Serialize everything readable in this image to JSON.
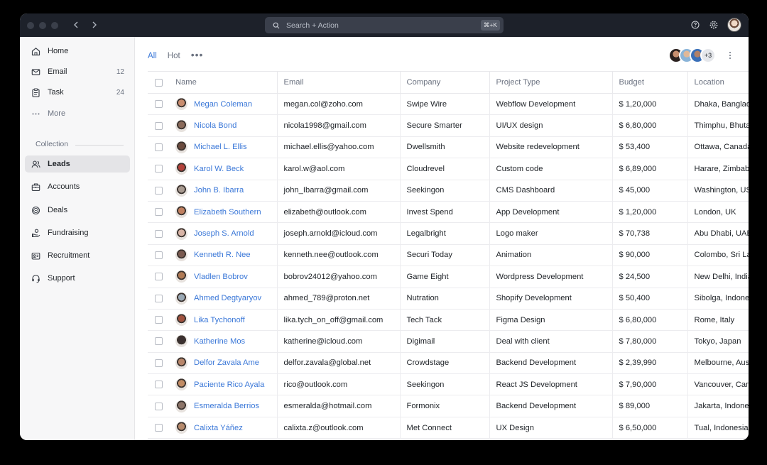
{
  "search": {
    "placeholder": "Search + Action",
    "shortcut": "⌘+K"
  },
  "sidebar": {
    "items": [
      {
        "label": "Home",
        "icon": "home-icon",
        "count": ""
      },
      {
        "label": "Email",
        "icon": "mail-icon",
        "count": "12"
      },
      {
        "label": "Task",
        "icon": "clipboard-icon",
        "count": "24"
      },
      {
        "label": "More",
        "icon": "more-dots-icon",
        "count": ""
      }
    ],
    "collection_label": "Collection",
    "collection": [
      {
        "label": "Leads",
        "icon": "users-icon",
        "active": true
      },
      {
        "label": "Accounts",
        "icon": "briefcase-icon"
      },
      {
        "label": "Deals",
        "icon": "coin-icon"
      },
      {
        "label": "Fundraising",
        "icon": "hand-coin-icon"
      },
      {
        "label": "Recruitment",
        "icon": "id-card-icon"
      },
      {
        "label": "Support",
        "icon": "headset-icon"
      }
    ]
  },
  "tabs": [
    {
      "label": "All",
      "active": true
    },
    {
      "label": "Hot",
      "active": false
    }
  ],
  "more_tabs": "•••",
  "collaborators": {
    "extra": "+3"
  },
  "table": {
    "columns": [
      "Name",
      "Email",
      "Company",
      "Project Type",
      "Budget",
      "Location"
    ],
    "rows": [
      {
        "name": "Megan Coleman",
        "email": "megan.col@zoho.com",
        "company": "Swipe Wire",
        "project": "Webflow Development",
        "budget": "$ 1,20,000",
        "location": "Dhaka,  Bangladesh",
        "color": "#c98d6f"
      },
      {
        "name": "Nicola Bond",
        "email": "nicola1998@gmail.com",
        "company": "Secure Smarter",
        "project": "UI/UX design",
        "budget": "$ 6,80,000",
        "location": "Thimphu, Bhutan",
        "color": "#8a6a5a"
      },
      {
        "name": "Michael L. Ellis",
        "email": "michael.ellis@yahoo.com",
        "company": "Dwellsmith",
        "project": "Website redevelopment",
        "budget": "$ 53,400",
        "location": "Ottawa, Canada",
        "color": "#6b4b3e"
      },
      {
        "name": "Karol W. Beck",
        "email": "karol.w@aol.com",
        "company": "Cloudrevel",
        "project": "Custom code",
        "budget": "$ 6,89,000",
        "location": "Harare, Zimbabwe",
        "color": "#b3413a"
      },
      {
        "name": "John B. Ibarra",
        "email": "john_Ibarra@gmail.com",
        "company": "Seekingon",
        "project": "CMS Dashboard",
        "budget": "$ 45,000",
        "location": "Washington, USA",
        "color": "#a89a90"
      },
      {
        "name": "Elizabeth Southern",
        "email": "elizabeth@outlook.com",
        "company": "Invest Spend",
        "project": "App Development",
        "budget": "$ 1,20,000",
        "location": "London, UK",
        "color": "#c08060"
      },
      {
        "name": "Joseph S. Arnold",
        "email": "joseph.arnold@icloud.com",
        "company": "Legalbright",
        "project": "Logo maker",
        "budget": "$ 70,738",
        "location": "Abu Dhabi, UAE",
        "color": "#d8b4a6"
      },
      {
        "name": "Kenneth R. Nee",
        "email": "kenneth.nee@outlook.com",
        "company": "Securi Today",
        "project": "Animation",
        "budget": "$ 90,000",
        "location": "Colombo, Sri Lanka",
        "color": "#7a5a50"
      },
      {
        "name": "Vladlen Bobrov",
        "email": "bobrov24012@yahoo.com",
        "company": "Game Eight",
        "project": "Wordpress Development",
        "budget": "$ 24,500",
        "location": "New Delhi, India",
        "color": "#b07a55"
      },
      {
        "name": "Ahmed Degtyaryov",
        "email": "ahmed_789@proton.net",
        "company": "Nutration",
        "project": "Shopify Development",
        "budget": "$ 50,400",
        "location": "Sibolga, Indonesia",
        "color": "#9aa8b4"
      },
      {
        "name": "Lika Tychonoff",
        "email": "lika.tych_on_off@gmail.com",
        "company": "Tech Tack",
        "project": "Figma Design",
        "budget": "$ 6,80,000",
        "location": "Rome, Italy",
        "color": "#a0523e"
      },
      {
        "name": "Katherine Mos",
        "email": "katherine@icloud.com",
        "company": "Digimail",
        "project": "Deal with client",
        "budget": "$ 7,80,000",
        "location": "Tokyo, Japan",
        "color": "#3b3030"
      },
      {
        "name": "Delfor Zavala Ame",
        "email": "delfor.zavala@global.net",
        "company": "Crowdstage",
        "project": "Backend Development",
        "budget": "$ 2,39,990",
        "location": "Melbourne, Australia",
        "color": "#b8866a"
      },
      {
        "name": "Paciente Rico Ayala",
        "email": "rico@outlook.com",
        "company": "Seekingon",
        "project": "React JS Development",
        "budget": "$ 7,90,000",
        "location": "Vancouver, Canada",
        "color": "#c28c64"
      },
      {
        "name": "Esmeralda Berrios",
        "email": "esmeralda@hotmail.com",
        "company": "Formonix",
        "project": "Backend Development",
        "budget": "$ 89,000",
        "location": "Jakarta, Indonesia",
        "color": "#8c7468"
      },
      {
        "name": "Calixta Yáñez",
        "email": "calixta.z@outlook.com",
        "company": "Met Connect",
        "project": "UX Design",
        "budget": "$ 6,50,000",
        "location": "Tual, Indonesia",
        "color": "#b68a6c"
      }
    ]
  }
}
